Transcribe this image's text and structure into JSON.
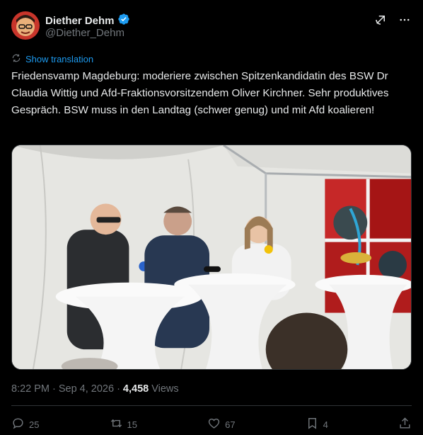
{
  "author": {
    "name": "Diether Dehm",
    "handle": "@Diether_Dehm"
  },
  "translate_label": "Show translation",
  "tweet_text": "Friedensvamp Magdeburg: moderiere zwischen Spitzenkandidatin des BSW Dr Claudia Wittig und Afd-Fraktionsvorsitzendem Oliver Kirchner. Sehr produktives Gespräch. BSW muss in den Landtag (schwer genug) und mit Afd koalieren!",
  "meta": {
    "time": "8:22 PM",
    "separator1": "·",
    "date": "Sep 4, 2026",
    "separator2": "·",
    "views_count": "4,458",
    "views_label": "Views"
  },
  "actions": {
    "replies": "25",
    "reposts": "15",
    "likes": "67",
    "bookmarks": "4"
  },
  "icons": [
    "verified-badge-icon",
    "grok-icon",
    "more-icon",
    "translate-icon",
    "reply-icon",
    "repost-icon",
    "like-icon",
    "bookmark-icon",
    "share-icon"
  ],
  "colors": {
    "background": "#000000",
    "accent": "#1d9bf0",
    "muted": "#71767b",
    "text": "#e7e9ea"
  }
}
